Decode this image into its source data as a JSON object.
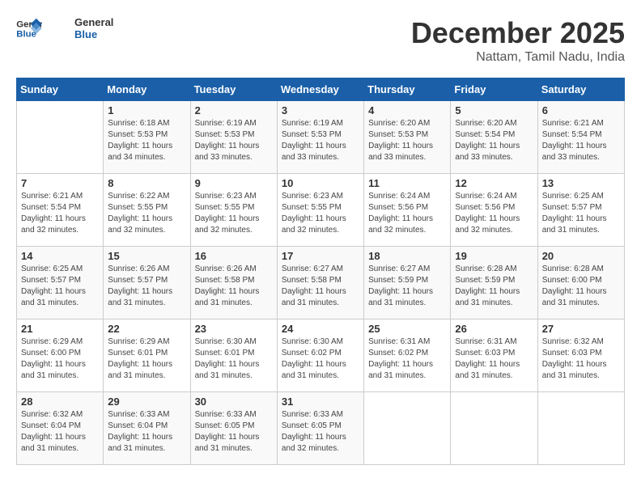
{
  "logo": {
    "line1": "General",
    "line2": "Blue"
  },
  "title": "December 2025",
  "location": "Nattam, Tamil Nadu, India",
  "header": {
    "days": [
      "Sunday",
      "Monday",
      "Tuesday",
      "Wednesday",
      "Thursday",
      "Friday",
      "Saturday"
    ]
  },
  "weeks": [
    [
      {
        "day": "",
        "info": ""
      },
      {
        "day": "1",
        "info": "Sunrise: 6:18 AM\nSunset: 5:53 PM\nDaylight: 11 hours\nand 34 minutes."
      },
      {
        "day": "2",
        "info": "Sunrise: 6:19 AM\nSunset: 5:53 PM\nDaylight: 11 hours\nand 33 minutes."
      },
      {
        "day": "3",
        "info": "Sunrise: 6:19 AM\nSunset: 5:53 PM\nDaylight: 11 hours\nand 33 minutes."
      },
      {
        "day": "4",
        "info": "Sunrise: 6:20 AM\nSunset: 5:53 PM\nDaylight: 11 hours\nand 33 minutes."
      },
      {
        "day": "5",
        "info": "Sunrise: 6:20 AM\nSunset: 5:54 PM\nDaylight: 11 hours\nand 33 minutes."
      },
      {
        "day": "6",
        "info": "Sunrise: 6:21 AM\nSunset: 5:54 PM\nDaylight: 11 hours\nand 33 minutes."
      }
    ],
    [
      {
        "day": "7",
        "info": "Sunrise: 6:21 AM\nSunset: 5:54 PM\nDaylight: 11 hours\nand 32 minutes."
      },
      {
        "day": "8",
        "info": "Sunrise: 6:22 AM\nSunset: 5:55 PM\nDaylight: 11 hours\nand 32 minutes."
      },
      {
        "day": "9",
        "info": "Sunrise: 6:23 AM\nSunset: 5:55 PM\nDaylight: 11 hours\nand 32 minutes."
      },
      {
        "day": "10",
        "info": "Sunrise: 6:23 AM\nSunset: 5:55 PM\nDaylight: 11 hours\nand 32 minutes."
      },
      {
        "day": "11",
        "info": "Sunrise: 6:24 AM\nSunset: 5:56 PM\nDaylight: 11 hours\nand 32 minutes."
      },
      {
        "day": "12",
        "info": "Sunrise: 6:24 AM\nSunset: 5:56 PM\nDaylight: 11 hours\nand 32 minutes."
      },
      {
        "day": "13",
        "info": "Sunrise: 6:25 AM\nSunset: 5:57 PM\nDaylight: 11 hours\nand 31 minutes."
      }
    ],
    [
      {
        "day": "14",
        "info": "Sunrise: 6:25 AM\nSunset: 5:57 PM\nDaylight: 11 hours\nand 31 minutes."
      },
      {
        "day": "15",
        "info": "Sunrise: 6:26 AM\nSunset: 5:57 PM\nDaylight: 11 hours\nand 31 minutes."
      },
      {
        "day": "16",
        "info": "Sunrise: 6:26 AM\nSunset: 5:58 PM\nDaylight: 11 hours\nand 31 minutes."
      },
      {
        "day": "17",
        "info": "Sunrise: 6:27 AM\nSunset: 5:58 PM\nDaylight: 11 hours\nand 31 minutes."
      },
      {
        "day": "18",
        "info": "Sunrise: 6:27 AM\nSunset: 5:59 PM\nDaylight: 11 hours\nand 31 minutes."
      },
      {
        "day": "19",
        "info": "Sunrise: 6:28 AM\nSunset: 5:59 PM\nDaylight: 11 hours\nand 31 minutes."
      },
      {
        "day": "20",
        "info": "Sunrise: 6:28 AM\nSunset: 6:00 PM\nDaylight: 11 hours\nand 31 minutes."
      }
    ],
    [
      {
        "day": "21",
        "info": "Sunrise: 6:29 AM\nSunset: 6:00 PM\nDaylight: 11 hours\nand 31 minutes."
      },
      {
        "day": "22",
        "info": "Sunrise: 6:29 AM\nSunset: 6:01 PM\nDaylight: 11 hours\nand 31 minutes."
      },
      {
        "day": "23",
        "info": "Sunrise: 6:30 AM\nSunset: 6:01 PM\nDaylight: 11 hours\nand 31 minutes."
      },
      {
        "day": "24",
        "info": "Sunrise: 6:30 AM\nSunset: 6:02 PM\nDaylight: 11 hours\nand 31 minutes."
      },
      {
        "day": "25",
        "info": "Sunrise: 6:31 AM\nSunset: 6:02 PM\nDaylight: 11 hours\nand 31 minutes."
      },
      {
        "day": "26",
        "info": "Sunrise: 6:31 AM\nSunset: 6:03 PM\nDaylight: 11 hours\nand 31 minutes."
      },
      {
        "day": "27",
        "info": "Sunrise: 6:32 AM\nSunset: 6:03 PM\nDaylight: 11 hours\nand 31 minutes."
      }
    ],
    [
      {
        "day": "28",
        "info": "Sunrise: 6:32 AM\nSunset: 6:04 PM\nDaylight: 11 hours\nand 31 minutes."
      },
      {
        "day": "29",
        "info": "Sunrise: 6:33 AM\nSunset: 6:04 PM\nDaylight: 11 hours\nand 31 minutes."
      },
      {
        "day": "30",
        "info": "Sunrise: 6:33 AM\nSunset: 6:05 PM\nDaylight: 11 hours\nand 31 minutes."
      },
      {
        "day": "31",
        "info": "Sunrise: 6:33 AM\nSunset: 6:05 PM\nDaylight: 11 hours\nand 32 minutes."
      },
      {
        "day": "",
        "info": ""
      },
      {
        "day": "",
        "info": ""
      },
      {
        "day": "",
        "info": ""
      }
    ]
  ]
}
